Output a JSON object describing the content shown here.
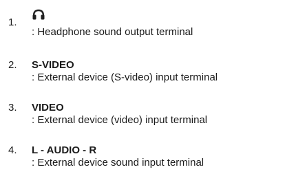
{
  "items": [
    {
      "number": "1.",
      "title": "",
      "icon": "headphone-icon",
      "description": ": Headphone sound output terminal"
    },
    {
      "number": "2.",
      "title": "S-VIDEO",
      "description": ": External device (S-video) input terminal"
    },
    {
      "number": "3.",
      "title": "VIDEO",
      "description": ": External device (video) input terminal"
    },
    {
      "number": "4.",
      "title": "L - AUDIO - R",
      "description": ": External device sound input terminal"
    }
  ]
}
